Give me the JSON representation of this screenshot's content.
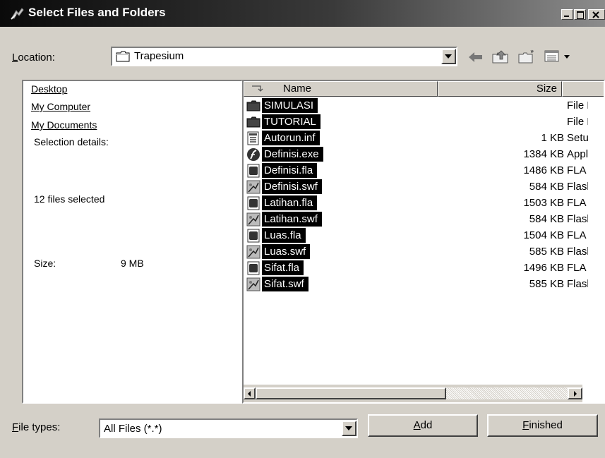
{
  "window": {
    "title": "Select Files and Folders",
    "controls": [
      "_",
      "□",
      "×"
    ]
  },
  "location": {
    "label_prefix": "",
    "label_hotkey": "L",
    "label_rest": "ocation:",
    "value": "Trapesium"
  },
  "left_panel": {
    "links": [
      "Desktop",
      "My Computer",
      "My Documents"
    ],
    "selection_details_label": "Selection details:",
    "files_selected": "12 files selected",
    "size_label": "Size:",
    "size_value": "9 MB"
  },
  "file_list": {
    "columns": {
      "name": "Name",
      "size": "Size"
    },
    "rows": [
      {
        "name": "SIMULASI",
        "size": "",
        "type": "File Folder",
        "icon": "folder-icon"
      },
      {
        "name": "TUTORIAL",
        "size": "",
        "type": "File Folder",
        "icon": "folder-icon"
      },
      {
        "name": "Autorun.inf",
        "size": "1 KB",
        "type": "Setup Information",
        "icon": "setup-file-icon"
      },
      {
        "name": "Definisi.exe",
        "size": "1384 KB",
        "type": "Application",
        "icon": "flash-exe-icon"
      },
      {
        "name": "Definisi.fla",
        "size": "1486 KB",
        "type": "FLA File",
        "icon": "fla-file-icon"
      },
      {
        "name": "Definisi.swf",
        "size": "584 KB",
        "type": "Flash Movie",
        "icon": "swf-file-icon"
      },
      {
        "name": "Latihan.fla",
        "size": "1503 KB",
        "type": "FLA File",
        "icon": "fla-file-icon"
      },
      {
        "name": "Latihan.swf",
        "size": "584 KB",
        "type": "Flash Movie",
        "icon": "swf-file-icon"
      },
      {
        "name": "Luas.fla",
        "size": "1504 KB",
        "type": "FLA File",
        "icon": "fla-file-icon"
      },
      {
        "name": "Luas.swf",
        "size": "585 KB",
        "type": "Flash Movie",
        "icon": "swf-file-icon"
      },
      {
        "name": "Sifat.fla",
        "size": "1496 KB",
        "type": "FLA File",
        "icon": "fla-file-icon"
      },
      {
        "name": "Sifat.swf",
        "size": "585 KB",
        "type": "Flash Movie",
        "icon": "swf-file-icon"
      }
    ]
  },
  "file_types": {
    "label_hotkey": "F",
    "label_rest": "ile types:",
    "value": "All Files (*.*)"
  },
  "buttons": {
    "add_hotkey": "A",
    "add_rest": "dd",
    "finished_hotkey": "F",
    "finished_rest": "inished"
  }
}
